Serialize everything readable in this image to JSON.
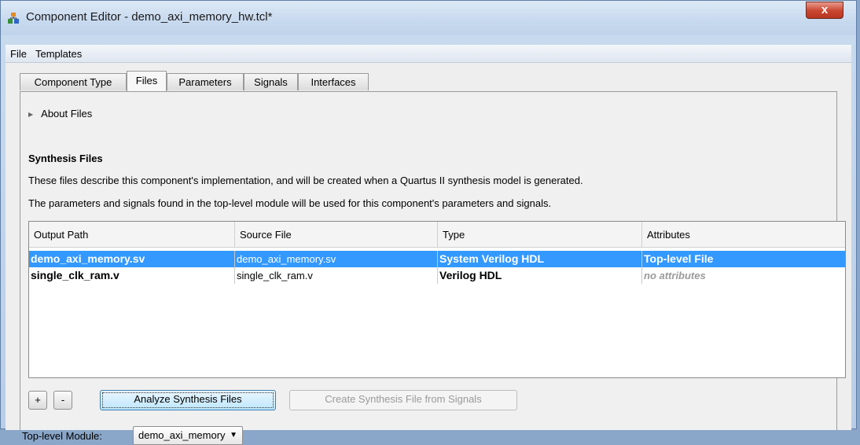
{
  "window": {
    "title": "Component Editor - demo_axi_memory_hw.tcl*",
    "close_glyph": "x"
  },
  "menu": [
    "File",
    "Templates"
  ],
  "tabs": [
    "Component Type",
    "Files",
    "Parameters",
    "Signals",
    "Interfaces"
  ],
  "active_tab": "Files",
  "about_label": "About Files",
  "synthesis": {
    "title": "Synthesis Files",
    "desc1": "These files describe this component's implementation, and will be created when a Quartus II synthesis model is generated.",
    "desc2": "The parameters and signals found in the top-level module will be used for this component's parameters and signals."
  },
  "table": {
    "headers": [
      "Output Path",
      "Source File",
      "Type",
      "Attributes"
    ],
    "rows": [
      {
        "output_path": "demo_axi_memory.sv",
        "source_file": "demo_axi_memory.sv",
        "type": "System Verilog HDL",
        "attributes": "Top-level File",
        "selected": true
      },
      {
        "output_path": "single_clk_ram.v",
        "source_file": "single_clk_ram.v",
        "type": "Verilog HDL",
        "attributes": "no attributes",
        "selected": false
      }
    ]
  },
  "buttons": {
    "add": "+",
    "remove": "-",
    "analyze": "Analyze Synthesis Files",
    "create": "Create Synthesis File from Signals"
  },
  "top_level": {
    "label": "Top-level Module:",
    "value": "demo_axi_memory"
  },
  "colors": {
    "selection": "#3399ff",
    "accent": "#3c7fb1"
  },
  "icons": {
    "app": "component-editor-icon",
    "close": "close-icon",
    "about_toggle": "triangle-right-icon",
    "dropdown": "chevron-down-icon"
  }
}
